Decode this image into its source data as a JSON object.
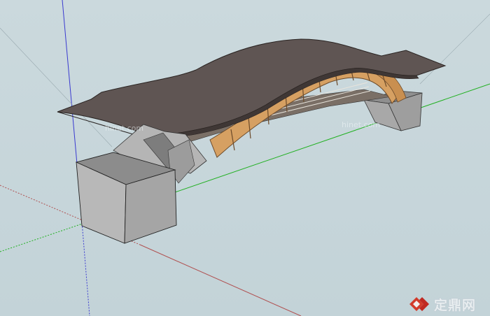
{
  "watermark": {
    "brand_text": "定鼎网",
    "faint_text_1": "hinet.com",
    "faint_text_2": "hinet.com"
  },
  "colors": {
    "background": "#c7d6da",
    "roof": "#5f5553",
    "wood": "#d9a062",
    "stone": "#a9a9a9",
    "axis_red": "#b05050",
    "axis_green": "#20b020",
    "axis_blue": "#3a3ad0",
    "watermark_red": "#d23b2b"
  },
  "icons": {
    "watermark_logo": "diamond-logo-icon"
  }
}
